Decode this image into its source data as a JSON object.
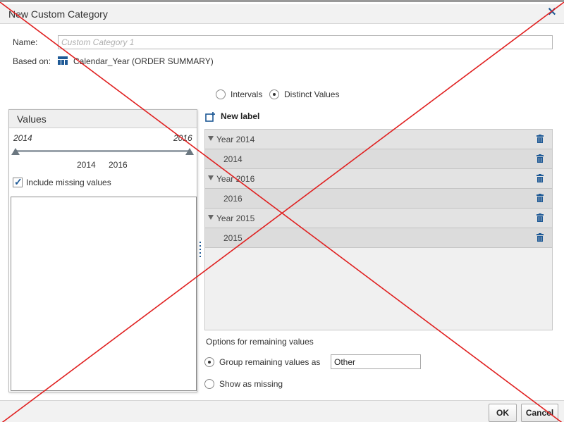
{
  "dialog": {
    "title": "New Custom Category",
    "close_icon": "close-icon"
  },
  "form": {
    "name_label": "Name:",
    "name_placeholder": "Custom Category 1",
    "name_value": "",
    "based_on_label": "Based on:",
    "based_on_icon": "hierarchy-icon",
    "based_on_value": "Calendar_Year (ORDER SUMMARY)"
  },
  "mode": {
    "intervals_label": "Intervals",
    "distinct_label": "Distinct Values",
    "selected": "distinct"
  },
  "values_panel": {
    "title": "Values",
    "range_min_label": "2014",
    "range_max_label": "2016",
    "selected_min": "2014",
    "selected_max": "2016",
    "include_missing_label": "Include missing values",
    "include_missing_checked": true
  },
  "groups": {
    "new_label": "New label",
    "rows": [
      {
        "type": "group",
        "label": "Year 2014"
      },
      {
        "type": "item",
        "label": "2014"
      },
      {
        "type": "group",
        "label": "Year 2016"
      },
      {
        "type": "item",
        "label": "2016"
      },
      {
        "type": "group",
        "label": "Year 2015"
      },
      {
        "type": "item",
        "label": "2015"
      }
    ]
  },
  "remaining": {
    "title": "Options for remaining values",
    "group_label": "Group remaining values as",
    "group_value": "Other",
    "missing_label": "Show as missing",
    "selected": "group"
  },
  "buttons": {
    "ok": "OK",
    "cancel": "Cancel"
  },
  "colors": {
    "accent": "#1f5a96",
    "overlay_cross": "#e02020"
  }
}
